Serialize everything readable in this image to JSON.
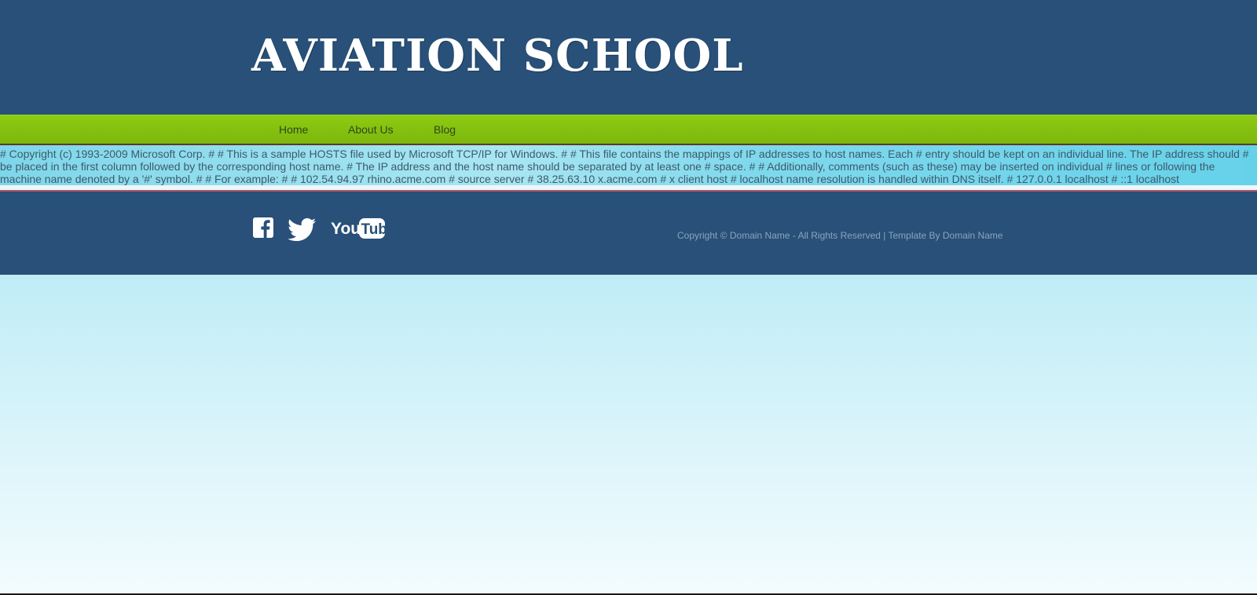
{
  "header": {
    "title": "AVIATION SCHOOL"
  },
  "nav": {
    "items": [
      {
        "label": "Home"
      },
      {
        "label": "About Us"
      },
      {
        "label": "Blog"
      }
    ]
  },
  "content": {
    "text": "# Copyright (c) 1993-2009 Microsoft Corp. # # This is a sample HOSTS file used by Microsoft TCP/IP for Windows. # # This file contains the mappings of IP addresses to host names. Each # entry should be kept on an individual line. The IP address should # be placed in the first column followed by the corresponding host name. # The IP address and the host name should be separated by at least one # space. # # Additionally, comments (such as these) may be inserted on individual # lines or following the machine name denoted by a '#' symbol. # # For example: # # 102.54.94.97 rhino.acme.com # source server # 38.25.63.10 x.acme.com # x client host # localhost name resolution is handled within DNS itself. # 127.0.0.1 localhost # ::1 localhost"
  },
  "footer": {
    "social": [
      {
        "icon": "facebook-icon"
      },
      {
        "icon": "twitter-icon"
      },
      {
        "icon": "youtube-icon"
      }
    ],
    "copyright": "Copyright © Domain Name - All Rights Reserved | Template By Domain Name"
  },
  "colors": {
    "header_bg": "#285078",
    "nav_bg": "#7db70c",
    "footer_bg": "#285078",
    "sky_top": "#8fdff0",
    "sky_bottom": "#f3fcfe"
  }
}
